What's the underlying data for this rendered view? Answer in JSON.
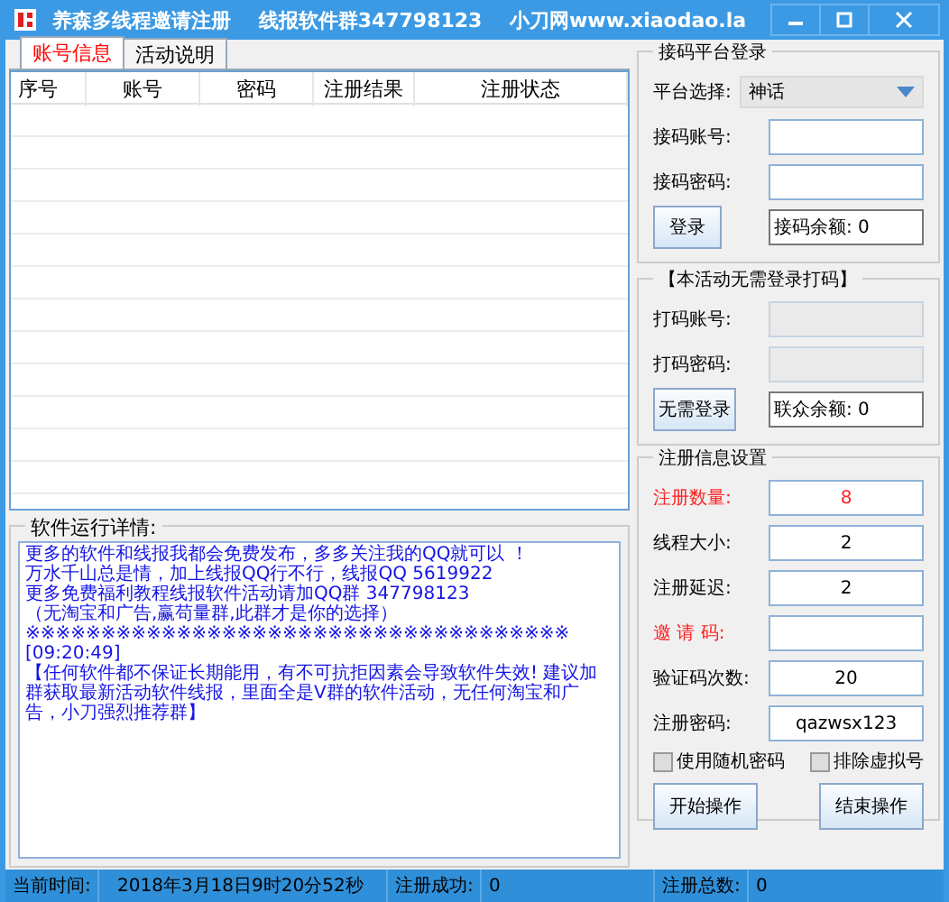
{
  "window": {
    "title": "养森多线程邀请注册    线报软件群347798123    小刀网www.xiaodao.la"
  },
  "tabs": [
    {
      "label": "账号信息",
      "selected": true
    },
    {
      "label": "活动说明",
      "selected": false
    }
  ],
  "table": {
    "columns": [
      "序号",
      "账号",
      "密码",
      "注册结果",
      "注册状态"
    ]
  },
  "log": {
    "title": "软件运行详情:",
    "lines": [
      "更多的软件和线报我都会免费发布，多多关注我的QQ就可以 ！",
      "万水千山总是情，加上线报QQ行不行，线报QQ 5619922",
      "更多免费福利教程线报软件活动请加QQ群 347798123",
      "（无淘宝和广告,赢苟量群,此群才是你的选择）",
      "※※※※※※※※※※※※※※※※※※※※※※※※※※※※※※※※※※※※",
      "[09:20:49]",
      "【任何软件都不保证长期能用，有不可抗拒因素会导致软件失效! 建议加群获取最新活动软件线报，里面全是V群的软件活动，无任何淘宝和广告，小刀强烈推荐群】"
    ]
  },
  "platform_login": {
    "title": "接码平台登录",
    "fields": [
      {
        "kind": "select",
        "label": "平台选择:",
        "value": "神话",
        "disabled": false
      },
      {
        "kind": "input",
        "label": "接码账号:",
        "disabled": false
      },
      {
        "kind": "input",
        "label": "接码密码:",
        "disabled": false
      }
    ],
    "button": "登录",
    "balance": "接码余额: 0"
  },
  "free_login": {
    "title": "【本活动无需登录打码】",
    "fields": [
      {
        "kind": "input",
        "label": "打码账号:",
        "disabled": true
      },
      {
        "kind": "input",
        "label": "打码密码:",
        "disabled": true
      }
    ],
    "button": "无需登录",
    "balance": "联众余额: 0"
  },
  "register_settings": {
    "title": "注册信息设置",
    "fields": [
      {
        "label": "注册数量:",
        "value": "8",
        "required": true
      },
      {
        "label": "线程大小:",
        "value": "2",
        "required": false
      },
      {
        "label": "注册延迟:",
        "value": "2",
        "required": false
      },
      {
        "label": "邀 请 码:",
        "required": true
      },
      {
        "label": "验证码次数:",
        "value": "20",
        "required": false
      },
      {
        "label": "注册密码:",
        "value": "qazwsx123",
        "required": false
      }
    ],
    "checkboxes": [
      {
        "label": "使用随机密码",
        "checked": false
      },
      {
        "label": "排除虚拟号",
        "checked": false
      }
    ],
    "buttons": [
      "开始操作",
      "结束操作"
    ]
  },
  "status_bar": [
    {
      "label": "当前时间:",
      "value": "2018年3月18日9时20分52秒"
    },
    {
      "label": "注册成功:",
      "value": "0"
    },
    {
      "label": "注册总数:",
      "value": "0"
    }
  ]
}
